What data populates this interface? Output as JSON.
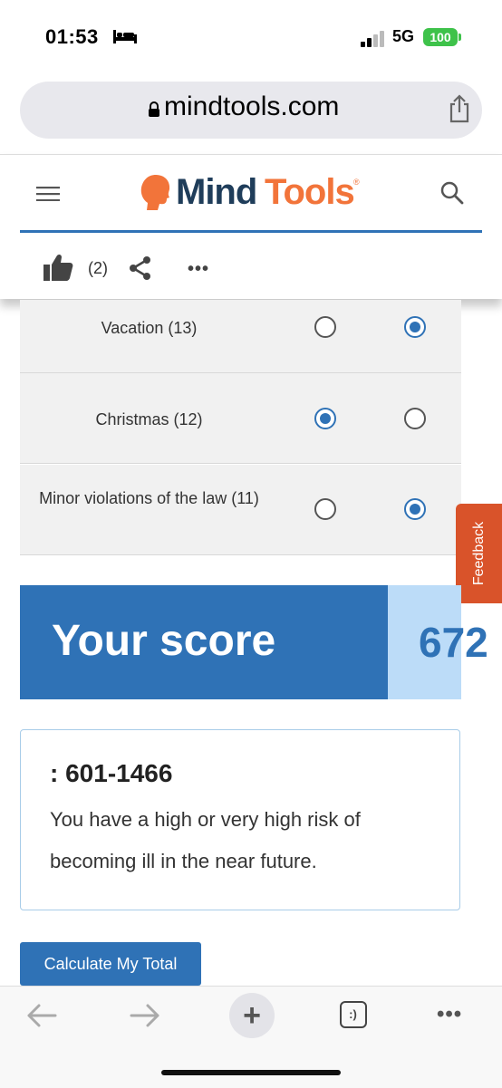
{
  "status_bar": {
    "time": "01:53",
    "network": "5G",
    "battery": "100",
    "icons": [
      "bed-icon",
      "signal-icon"
    ]
  },
  "browser": {
    "url": "mindtools.com",
    "icons": [
      "lock-icon",
      "share-icon"
    ]
  },
  "header": {
    "logo_part1": "Mind",
    "logo_part2": "Tools",
    "logo_reg": "®",
    "icons": [
      "hamburger-icon",
      "search-icon"
    ]
  },
  "social": {
    "like_count": "(2)",
    "more": "•••",
    "icons": [
      "thumbs-up-icon",
      "share-network-icon"
    ]
  },
  "events": [
    {
      "label": "Vacation (13)",
      "selected": 2
    },
    {
      "label": "Christmas (12)",
      "selected": 1
    },
    {
      "label": "Minor violations of the law (11)",
      "selected": 2
    }
  ],
  "feedback_label": "Feedback",
  "score": {
    "label": "Your score",
    "value": "672"
  },
  "result": {
    "range": ": 601-1466",
    "text": "You have a high or very high risk of becoming ill in the near future."
  },
  "calculate_button": "Calculate My Total",
  "bottom_bar": {
    "plus": "+",
    "tabs": ":)",
    "more": "•••",
    "icons": [
      "back-arrow-icon",
      "forward-arrow-icon"
    ]
  },
  "colors": {
    "brand_blue": "#2f72b6",
    "brand_orange": "#f2743a",
    "brand_navy": "#1f3d5a",
    "feedback_orange": "#d9532a",
    "score_light": "#bcdcf8"
  }
}
